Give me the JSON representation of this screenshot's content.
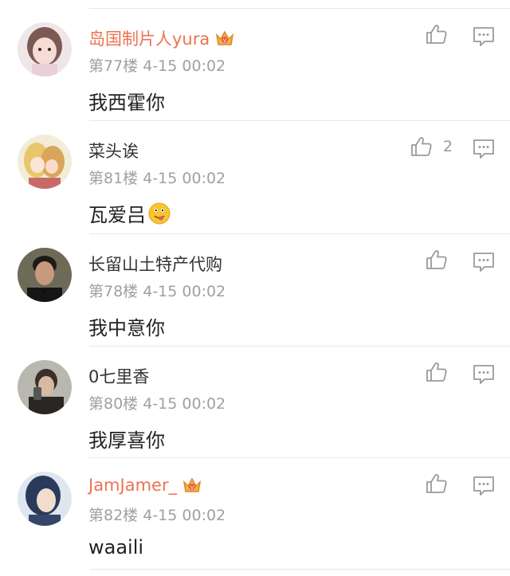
{
  "comments": [
    {
      "username": "岛国制片人yura",
      "vip": true,
      "floor": "第77楼",
      "time": "4-15 00:02",
      "text": "我西霍你",
      "likes": "",
      "avatar": "avatar-girl-pink"
    },
    {
      "username": "菜头诶",
      "vip": false,
      "floor": "第81楼",
      "time": "4-15 00:02",
      "text": "瓦爱吕",
      "likes": "2",
      "avatar": "avatar-anime-pair",
      "emoji": "smiley-tongue-emoji"
    },
    {
      "username": "长留山土特产代购",
      "vip": false,
      "floor": "第78楼",
      "time": "4-15 00:02",
      "text": "我中意你",
      "likes": "",
      "avatar": "avatar-man-bowtie"
    },
    {
      "username": "0七里香",
      "vip": false,
      "floor": "第80楼",
      "time": "4-15 00:02",
      "text": "我厚喜你",
      "likes": "",
      "avatar": "avatar-selfie"
    },
    {
      "username": "JamJamer_",
      "vip": true,
      "floor": "第82楼",
      "time": "4-15 00:02",
      "text": "waaili",
      "likes": "",
      "avatar": "avatar-girl-portrait"
    }
  ],
  "colors": {
    "vip_name": "#eb7350",
    "name": "#333333",
    "meta": "#a0a0a0",
    "icon": "#9a9a9a"
  }
}
